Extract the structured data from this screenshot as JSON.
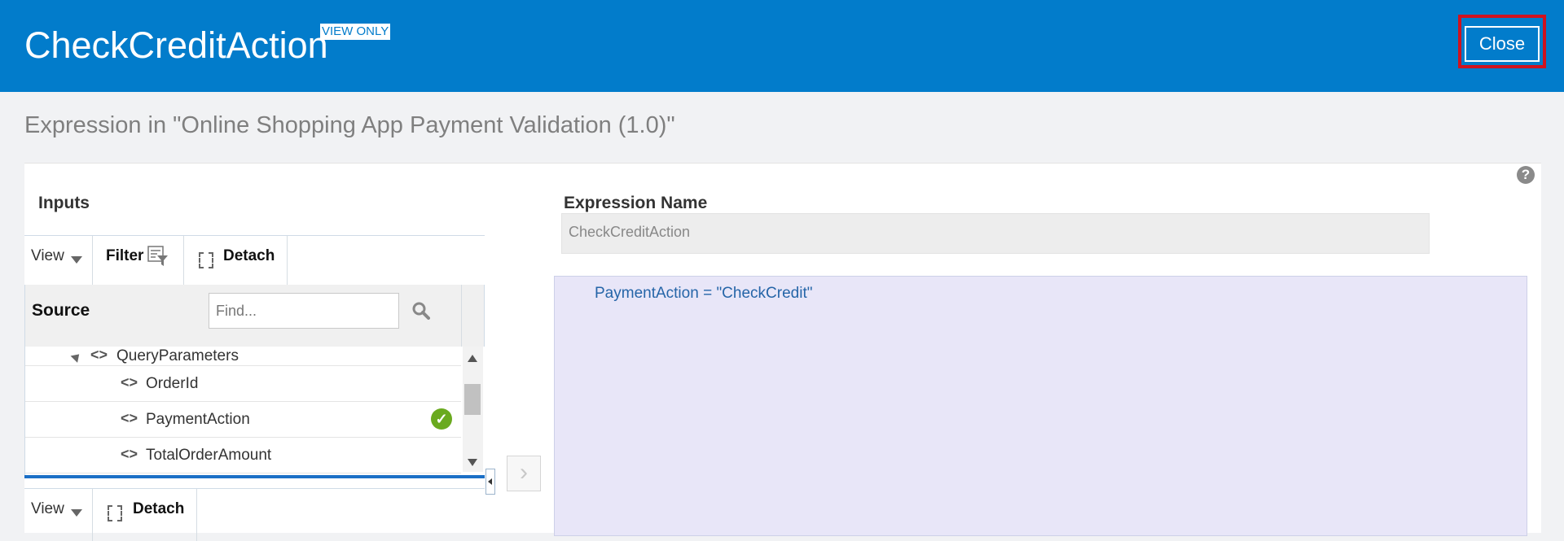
{
  "header": {
    "title": "CheckCreditAction",
    "badge": "VIEW ONLY",
    "close_label": "Close",
    "bg_color": "#027ccb"
  },
  "subtitle": "Expression in \"Online Shopping App Payment Validation (1.0)\"",
  "inputs": {
    "label": "Inputs",
    "toolbar": {
      "view_label": "View",
      "filter_label": "Filter",
      "detach_label": "Detach"
    },
    "source": {
      "label": "Source",
      "find_placeholder": "Find...",
      "tree": [
        {
          "label": "QueryParameters",
          "icon": "code-icon",
          "expanded": true
        },
        {
          "label": "OrderId",
          "icon": "code-icon"
        },
        {
          "label": "PaymentAction",
          "icon": "code-icon",
          "selected": true,
          "status": "check-icon"
        },
        {
          "label": "TotalOrderAmount",
          "icon": "code-icon"
        }
      ]
    },
    "bottom_toolbar": {
      "view_label": "View",
      "detach_label": "Detach"
    }
  },
  "expression": {
    "name_label": "Expression Name",
    "name_value": "CheckCreditAction",
    "code": "PaymentAction = \"CheckCredit\""
  },
  "colors": {
    "accent": "#027ccb",
    "highlight_border": "#d0121f",
    "editor_bg": "#e8e6f8",
    "check_green": "#6aaa1f"
  }
}
